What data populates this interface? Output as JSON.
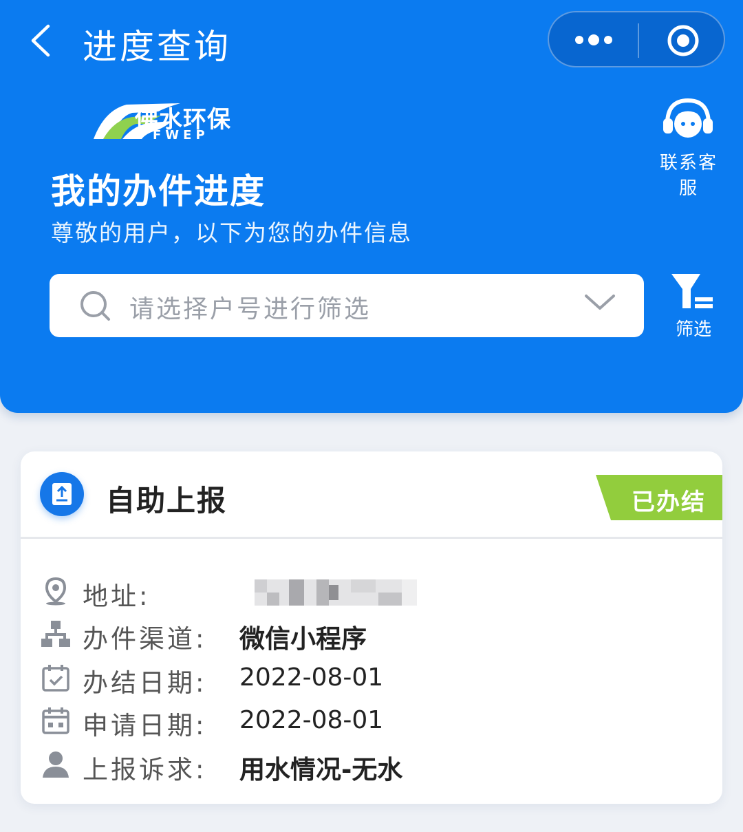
{
  "nav": {
    "title": "进度查询"
  },
  "brand": {
    "name_cn": "佛水环保",
    "name_en": "FWEP"
  },
  "service": {
    "label": "联系客服"
  },
  "page": {
    "title": "我的办件进度",
    "subtitle": "尊敬的用户，以下为您的办件信息"
  },
  "search": {
    "placeholder": "请选择户号进行筛选"
  },
  "filter": {
    "label": "筛选"
  },
  "card": {
    "title": "自助上报",
    "status": "已办结",
    "rows": [
      {
        "icon": "location-pin-icon",
        "label": "地址:",
        "value": ""
      },
      {
        "icon": "org-tree-icon",
        "label": "办件渠道:",
        "value": "微信小程序"
      },
      {
        "icon": "calendar-check-icon",
        "label": "办结日期:",
        "value": "2022-08-01"
      },
      {
        "icon": "calendar-icon",
        "label": "申请日期:",
        "value": "2022-08-01"
      },
      {
        "icon": "user-icon",
        "label": "上报诉求:",
        "value": "用水情况-无水"
      }
    ]
  },
  "colors": {
    "primary": "#0b7bf0",
    "status_done": "#92cd3d",
    "card_bg": "#ffffff"
  }
}
